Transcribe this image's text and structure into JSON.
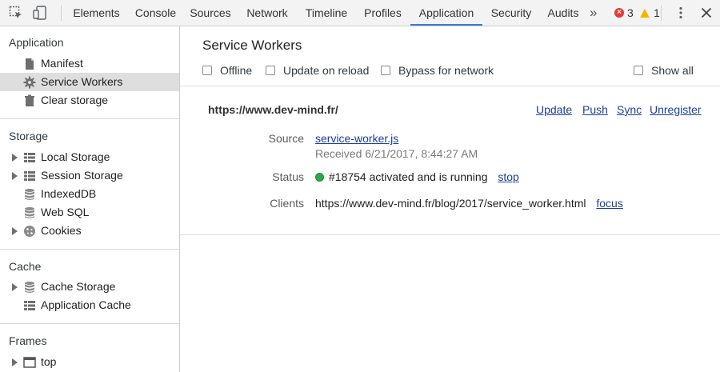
{
  "toolbar": {
    "tabs": [
      {
        "label": "Elements"
      },
      {
        "label": "Console"
      },
      {
        "label": "Sources"
      },
      {
        "label": "Network"
      },
      {
        "label": "Timeline"
      },
      {
        "label": "Profiles"
      },
      {
        "label": "Application",
        "active": true
      },
      {
        "label": "Security"
      },
      {
        "label": "Audits"
      }
    ],
    "more_label": "»",
    "error_count": "3",
    "warning_count": "1",
    "colors": {
      "active_tab_underline": "#3879d9",
      "error": "#e53935",
      "warning": "#f4b400"
    }
  },
  "sidebar": {
    "sections": [
      {
        "title": "Application",
        "items": [
          {
            "label": "Manifest",
            "icon": "document-icon"
          },
          {
            "label": "Service Workers",
            "icon": "gear-icon",
            "selected": true
          },
          {
            "label": "Clear storage",
            "icon": "trash-icon"
          }
        ]
      },
      {
        "title": "Storage",
        "items": [
          {
            "label": "Local Storage",
            "icon": "grid-icon",
            "expandable": true
          },
          {
            "label": "Session Storage",
            "icon": "grid-icon",
            "expandable": true
          },
          {
            "label": "IndexedDB",
            "icon": "database-icon"
          },
          {
            "label": "Web SQL",
            "icon": "database-icon"
          },
          {
            "label": "Cookies",
            "icon": "cookie-icon",
            "expandable": true
          }
        ]
      },
      {
        "title": "Cache",
        "items": [
          {
            "label": "Cache Storage",
            "icon": "database-icon",
            "expandable": true
          },
          {
            "label": "Application Cache",
            "icon": "grid-icon"
          }
        ]
      },
      {
        "title": "Frames",
        "items": [
          {
            "label": "top",
            "icon": "frame-icon",
            "expandable": true
          }
        ]
      }
    ]
  },
  "main": {
    "title": "Service Workers",
    "options": {
      "offline": "Offline",
      "update_on_reload": "Update on reload",
      "bypass_for_network": "Bypass for network",
      "show_all": "Show all"
    },
    "worker": {
      "origin": "https://www.dev-mind.fr/",
      "actions": {
        "update": "Update",
        "push": "Push",
        "sync": "Sync",
        "unregister": "Unregister"
      },
      "source_label": "Source",
      "source_file": "service-worker.js",
      "received": "Received 6/21/2017, 8:44:27 AM",
      "status_label": "Status",
      "status_text": "#18754 activated and is running",
      "status_action": "stop",
      "status_color": "#2ea84a",
      "clients_label": "Clients",
      "client_url": "https://www.dev-mind.fr/blog/2017/service_worker.html",
      "client_action": "focus"
    }
  }
}
